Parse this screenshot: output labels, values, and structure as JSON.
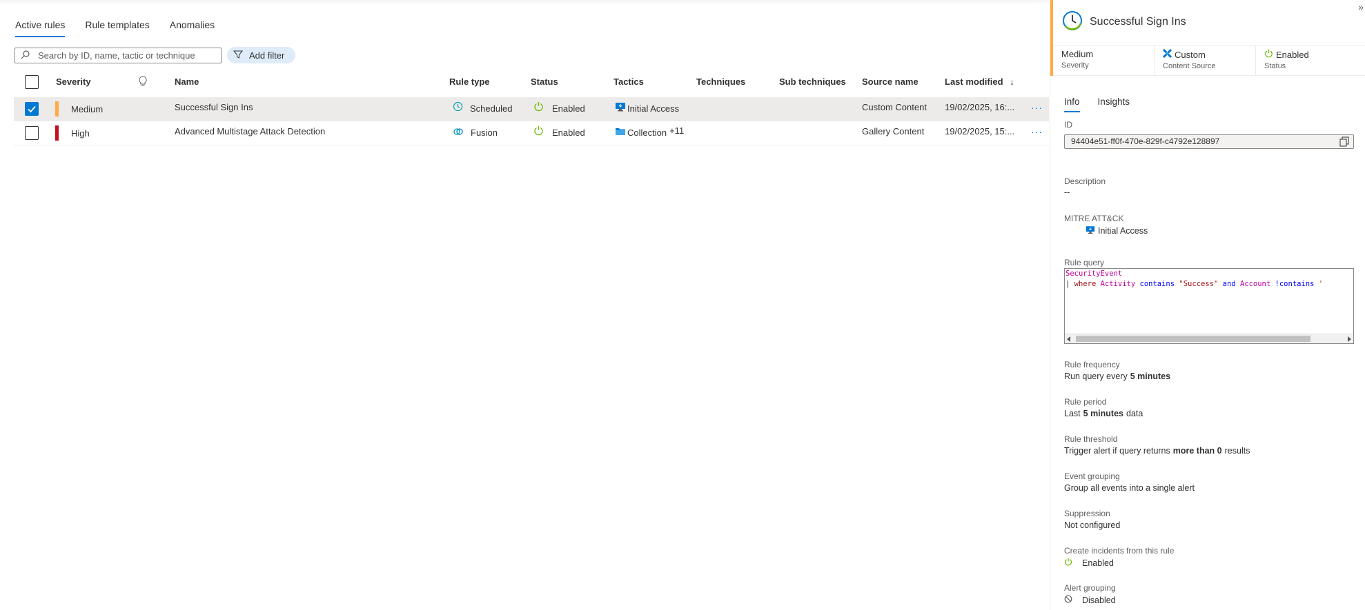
{
  "tabs": [
    "Active rules",
    "Rule templates",
    "Anomalies"
  ],
  "search": {
    "placeholder": "Search by ID, name, tactic or technique"
  },
  "add_filter": "Add filter",
  "columns": {
    "severity": "Severity",
    "name": "Name",
    "rule_type": "Rule type",
    "status": "Status",
    "tactics": "Tactics",
    "techniques": "Techniques",
    "sub_techniques": "Sub techniques",
    "source_name": "Source name",
    "last_modified": "Last modified",
    "sort_arrow": "↓"
  },
  "rows": [
    {
      "checked": true,
      "severity": "Medium",
      "severity_color": "#ffaa44",
      "name": "Successful Sign Ins",
      "rule_type": "Scheduled",
      "status": "Enabled",
      "tactic": "Initial Access",
      "tactic_extra": "",
      "source_name": "Custom Content",
      "last_modified": "19/02/2025, 16:...",
      "more": "···"
    },
    {
      "checked": false,
      "severity": "High",
      "severity_color": "#c50f1f",
      "name": "Advanced Multistage Attack Detection",
      "rule_type": "Fusion",
      "status": "Enabled",
      "tactic": "Collection",
      "tactic_extra": "+11",
      "source_name": "Gallery Content",
      "last_modified": "19/02/2025, 15:...",
      "more": "···"
    }
  ],
  "panel": {
    "title": "Successful Sign Ins",
    "collapse": "»",
    "summary": [
      {
        "value": "Medium",
        "label": "Severity"
      },
      {
        "value": "Custom",
        "label": "Content Source"
      },
      {
        "value": "Enabled",
        "label": "Status"
      }
    ],
    "tabs": [
      "Info",
      "Insights"
    ],
    "id_label": "ID",
    "id_value": "94404e51-ff0f-470e-829f-c4792e128897",
    "description_label": "Description",
    "description_value": "--",
    "mitre_label": "MITRE ATT&CK",
    "mitre_value": "Initial Access",
    "query_label": "Rule query",
    "query": {
      "line1_table": "SecurityEvent",
      "pipe": "|",
      "where": "where",
      "field1": "Activity",
      "contains": "contains",
      "string1": "\"Success\"",
      "and": "and",
      "field2": "Account",
      "not_contains": "!contains",
      "tail": "'"
    },
    "frequency_label": "Rule frequency",
    "frequency": {
      "prefix": "Run query every",
      "bold": "5 minutes"
    },
    "period_label": "Rule period",
    "period": {
      "prefix": "Last",
      "bold": "5 minutes",
      "suffix": "data"
    },
    "threshold_label": "Rule threshold",
    "threshold": {
      "prefix": "Trigger alert if query returns",
      "bold": "more than 0",
      "suffix": "results"
    },
    "grouping_label": "Event grouping",
    "grouping_value": "Group all events into a single alert",
    "suppression_label": "Suppression",
    "suppression_value": "Not configured",
    "incidents_label": "Create incidents from this rule",
    "incidents_value": "Enabled",
    "alert_grouping_label": "Alert grouping",
    "alert_grouping_value": "Disabled"
  },
  "colors": {
    "accent": "#0078d4",
    "medium": "#ffaa44",
    "high": "#c50f1f",
    "enabled_green": "#6bb700",
    "kql_table": "#c4009a",
    "kql_keyword": "#0000ff",
    "kql_field": "#c4009a",
    "kql_string": "#a31515",
    "kql_operator": "#a31515"
  }
}
